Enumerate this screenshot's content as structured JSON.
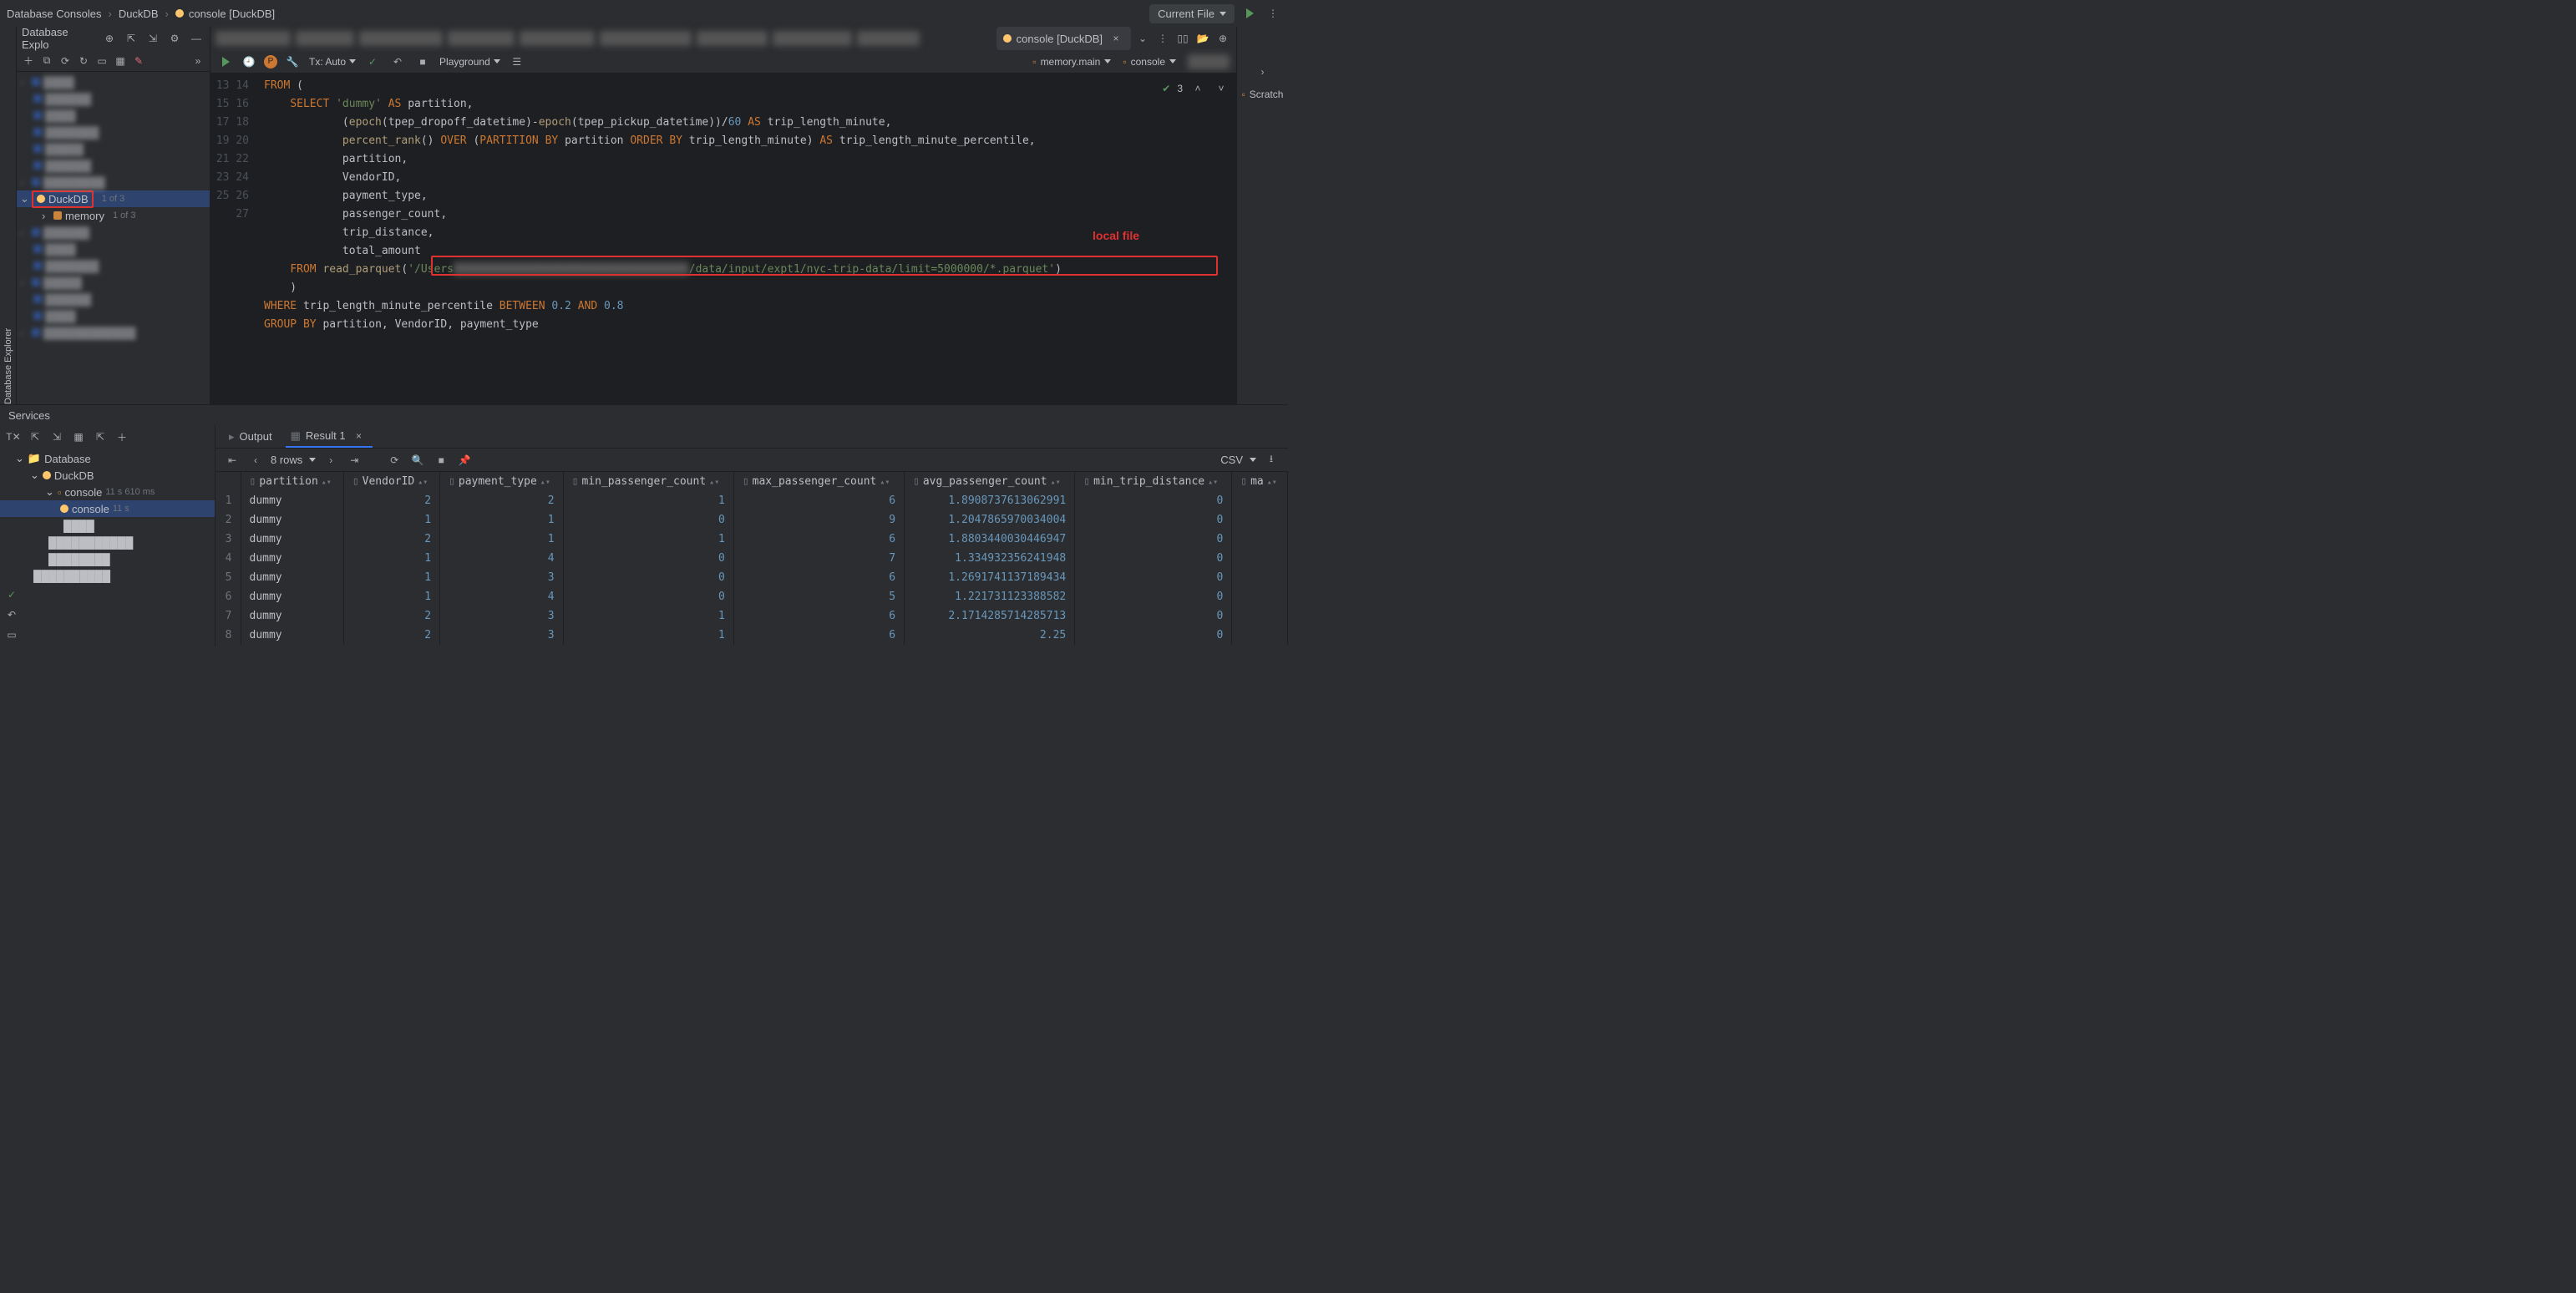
{
  "breadcrumbs": [
    "Database Consoles",
    "DuckDB",
    "console [DuckDB]"
  ],
  "run_selector": "Current File",
  "panels": {
    "left_title": "Database Explo",
    "side_tab": "Database Explorer",
    "services_title": "Services",
    "right_item": "Scratch"
  },
  "db_tree": {
    "duckdb_label": "DuckDB",
    "duckdb_badge": "1 of 3",
    "memory_label": "memory",
    "memory_badge": "1 of 3"
  },
  "editor": {
    "tab_label": "console [DuckDB]",
    "tx_mode": "Tx: Auto",
    "playground": "Playground",
    "datasource": "memory.main",
    "console_sel": "console",
    "status_count": "3",
    "lines": [
      13,
      14,
      15,
      16,
      17,
      18,
      19,
      20,
      21,
      22,
      23,
      24,
      25,
      26,
      27
    ]
  },
  "annotations": {
    "local_file": "local file",
    "path_prefix": "'/Users",
    "path_suffix": "/data/input/expt1/nyc-trip-data/limit=5000000/*.parquet'"
  },
  "svc_tree": {
    "database": "Database",
    "duckdb": "DuckDB",
    "console1": "console",
    "console1_time": "11 s 610 ms",
    "console2": "console",
    "console2_time": "11 s"
  },
  "results": {
    "output_tab": "Output",
    "result_tab": "Result 1",
    "row_count": "8 rows",
    "export": "CSV",
    "columns": [
      "partition",
      "VendorID",
      "payment_type",
      "min_passenger_count",
      "max_passenger_count",
      "avg_passenger_count",
      "min_trip_distance",
      "ma"
    ],
    "rows": [
      {
        "n": 1,
        "partition": "dummy",
        "VendorID": 2,
        "payment_type": 2,
        "min_passenger_count": 1,
        "max_passenger_count": 6,
        "avg_passenger_count": "1.8908737613062991",
        "min_trip_distance": 0
      },
      {
        "n": 2,
        "partition": "dummy",
        "VendorID": 1,
        "payment_type": 1,
        "min_passenger_count": 0,
        "max_passenger_count": 9,
        "avg_passenger_count": "1.2047865970034004",
        "min_trip_distance": 0
      },
      {
        "n": 3,
        "partition": "dummy",
        "VendorID": 2,
        "payment_type": 1,
        "min_passenger_count": 1,
        "max_passenger_count": 6,
        "avg_passenger_count": "1.8803440030446947",
        "min_trip_distance": 0
      },
      {
        "n": 4,
        "partition": "dummy",
        "VendorID": 1,
        "payment_type": 4,
        "min_passenger_count": 0,
        "max_passenger_count": 7,
        "avg_passenger_count": "1.334932356241948",
        "min_trip_distance": 0
      },
      {
        "n": 5,
        "partition": "dummy",
        "VendorID": 1,
        "payment_type": 3,
        "min_passenger_count": 0,
        "max_passenger_count": 6,
        "avg_passenger_count": "1.2691741137189434",
        "min_trip_distance": 0
      },
      {
        "n": 6,
        "partition": "dummy",
        "VendorID": 1,
        "payment_type": 4,
        "min_passenger_count": 0,
        "max_passenger_count": 5,
        "avg_passenger_count": "1.221731123388582",
        "min_trip_distance": 0
      },
      {
        "n": 7,
        "partition": "dummy",
        "VendorID": 2,
        "payment_type": 3,
        "min_passenger_count": 1,
        "max_passenger_count": 6,
        "avg_passenger_count": "2.1714285714285713",
        "min_trip_distance": 0
      },
      {
        "n": 8,
        "partition": "dummy",
        "VendorID": 2,
        "payment_type": 3,
        "min_passenger_count": 1,
        "max_passenger_count": 6,
        "avg_passenger_count": "2.25",
        "min_trip_distance": 0
      }
    ]
  }
}
